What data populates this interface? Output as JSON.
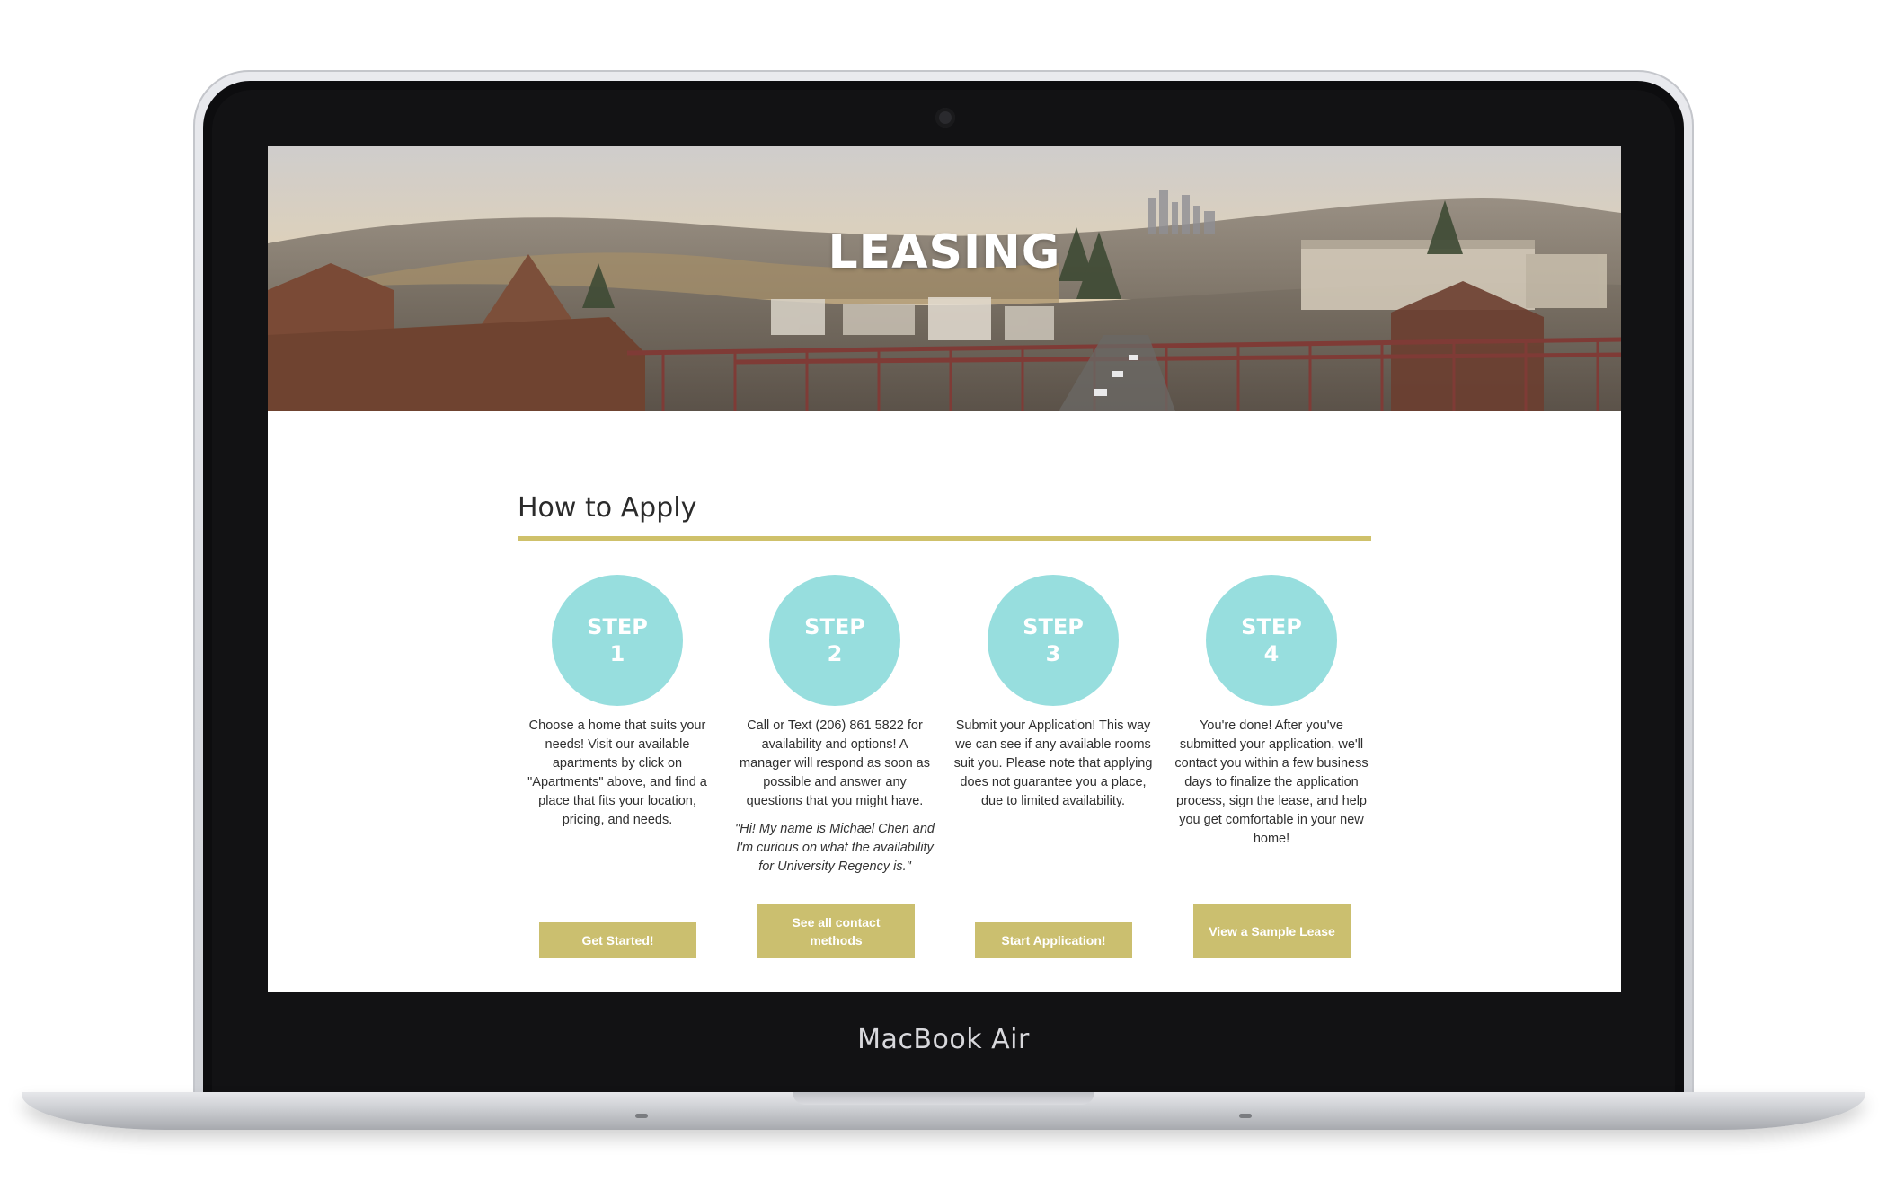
{
  "device": {
    "label": "MacBook Air"
  },
  "hero": {
    "title": "LEASING"
  },
  "section": {
    "title": "How to Apply"
  },
  "steps": [
    {
      "label": "STEP",
      "number": "1",
      "text": "Choose a home that suits your needs! Visit our available apartments by click on \"Apartments\" above, and find a place that fits your location, pricing, and needs.",
      "quote": "",
      "button": "Get Started!"
    },
    {
      "label": "STEP",
      "number": "2",
      "text": "Call or Text (206) 861 5822 for availability and options! A manager will respond as soon as possible and answer any questions that you might have.",
      "quote": "\"Hi! My name is Michael Chen and I'm curious on what the availability for University Regency is.\"",
      "button": "See all contact methods"
    },
    {
      "label": "STEP",
      "number": "3",
      "text": "Submit your Application! This way we can see if any available rooms suit you. Please note that applying does not guarantee you a place, due to limited availability.",
      "quote": "",
      "button": "Start Application!"
    },
    {
      "label": "STEP",
      "number": "4",
      "text": "You're done! After you've submitted your application, we'll contact you within a few business days to finalize the application process, sign the lease, and help you get comfortable in your new home!",
      "quote": "",
      "button": "View a Sample Lease"
    }
  ],
  "colors": {
    "accent_gold": "#cbbf6f",
    "step_circle": "#97dede",
    "rule": "#cfc16b"
  }
}
